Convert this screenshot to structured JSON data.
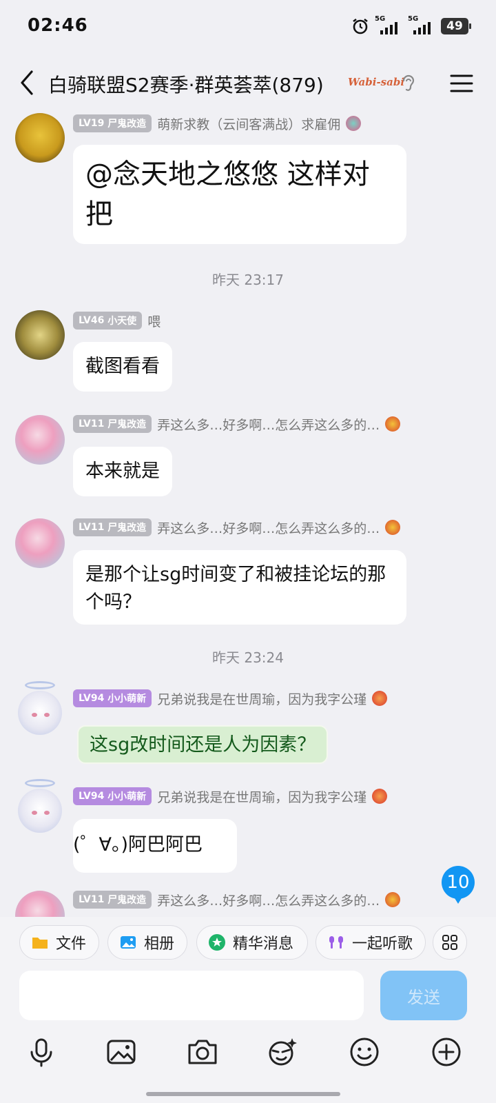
{
  "status_bar": {
    "time": "02:46",
    "signal1": "5G",
    "signal2": "5G",
    "battery": "49"
  },
  "header": {
    "title": "白骑联盟S2赛季·群英荟萃(879)",
    "badge": "Wabi-sabi"
  },
  "messages": [
    {
      "level": "LV19",
      "title": "尸鬼改造",
      "nick": "萌新求教（云间客满战）求雇佣",
      "text": "@念天地之悠悠 这样对把"
    },
    {
      "level": "LV46",
      "title": "小天使",
      "nick": "喂",
      "text": "截图看看"
    },
    {
      "level": "LV11",
      "title": "尸鬼改造",
      "nick": "弄这么多…好多啊…怎么弄这么多的…",
      "text": "本来就是"
    },
    {
      "level": "LV11",
      "title": "尸鬼改造",
      "nick": "弄这么多…好多啊…怎么弄这么多的…",
      "text": "是那个让sg时间变了和被挂论坛的那个吗？"
    },
    {
      "level": "LV94",
      "title": "小小萌新",
      "nick": "兄弟说我是在世周瑜，因为我字公瑾",
      "text": "这sg改时间还是人为因素？"
    },
    {
      "level": "LV94",
      "title": "小小萌新",
      "nick": "兄弟说我是在世周瑜，因为我字公瑾",
      "text": "(゜∀。)阿巴阿巴"
    },
    {
      "level": "LV11",
      "title": "尸鬼改造",
      "nick": "弄这么多…好多啊…怎么弄这么多的…",
      "text": ""
    }
  ],
  "timestamps": [
    "昨天 23:17",
    "昨天 23:24"
  ],
  "unread_count": "10",
  "quick_actions": [
    "文件",
    "相册",
    "精华消息",
    "一起听歌"
  ],
  "input": {
    "placeholder": "",
    "send_label": "发送"
  },
  "colors": {
    "send_button": "#81c3f6",
    "unread_badge": "#1296f3",
    "level_purple": "#b58be0",
    "level_gray": "#b9b9bf"
  }
}
